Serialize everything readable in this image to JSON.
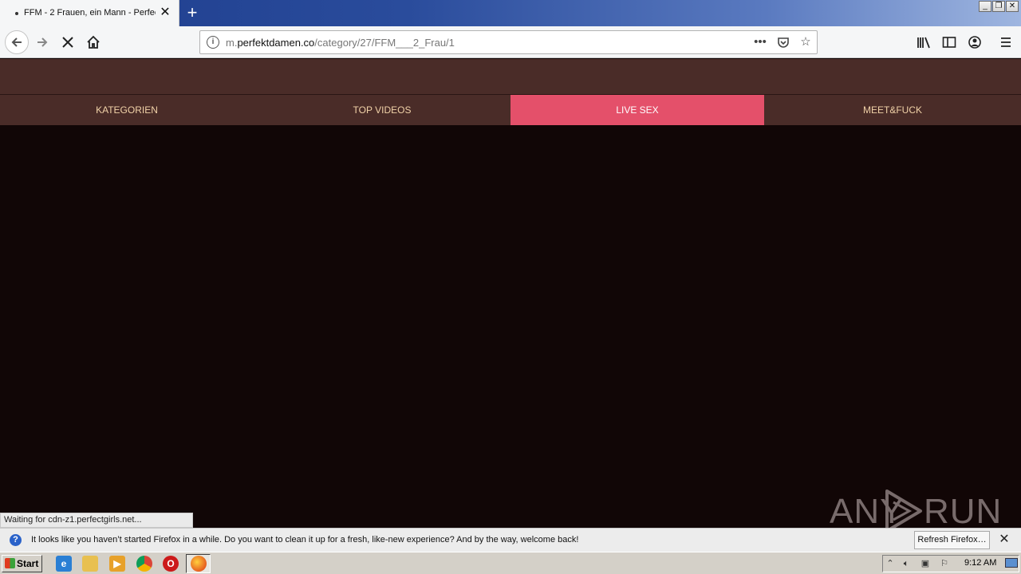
{
  "browser": {
    "tab": {
      "title": "FFM - 2 Frauen, ein Mann - Perfec",
      "close_glyph": "✕"
    },
    "new_tab_glyph": "+",
    "window_controls": [
      "_",
      "❐",
      "✕"
    ],
    "url": {
      "prefix": "m.",
      "domain": "perfektdamen.co",
      "path": "/category/27/FFM___2_Frau/1"
    },
    "status_text": "Waiting for cdn-z1.perfectgirls.net..."
  },
  "site": {
    "nav_items": [
      {
        "label": "KATEGORIEN",
        "active": false
      },
      {
        "label": "TOP VIDEOS",
        "active": false
      },
      {
        "label": "LIVE SEX",
        "active": true
      },
      {
        "label": "MEET&FUCK",
        "active": false
      }
    ],
    "colors": {
      "header_bg": "#4a2c28",
      "nav_text": "#f1d2a8",
      "active_bg": "#e4506a",
      "body_bg": "#110606"
    }
  },
  "watermark": {
    "left": "ANY",
    "right": "RUN"
  },
  "notification": {
    "text": "It looks like you haven’t started Firefox in a while. Do you want to clean it up for a fresh, like-new experience? And by the way, welcome back!",
    "button": "Refresh Firefox…",
    "close_glyph": "✕"
  },
  "taskbar": {
    "start_label": "Start",
    "clock": "9:12 AM"
  }
}
